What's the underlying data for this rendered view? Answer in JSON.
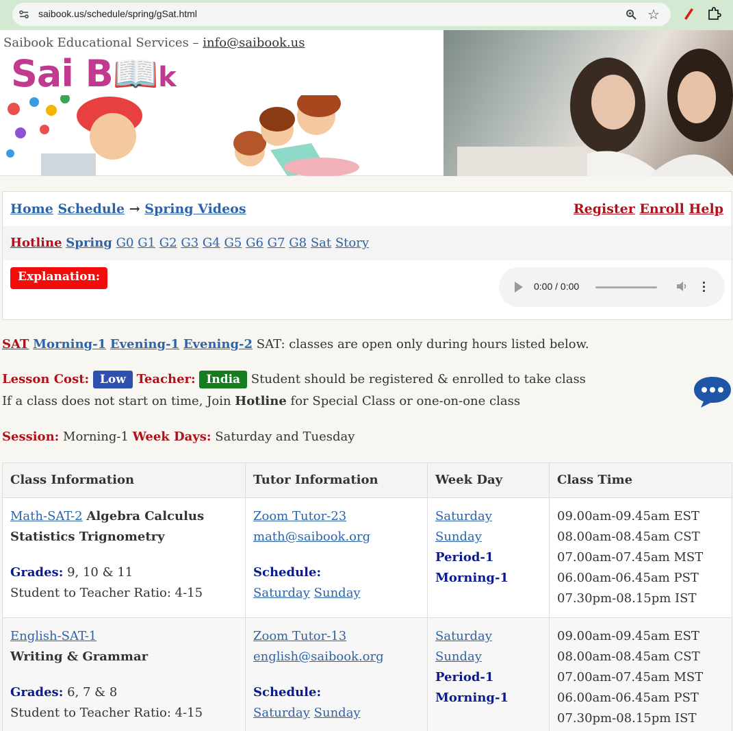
{
  "browser": {
    "url": "saibook.us/schedule/spring/gSat.html"
  },
  "header": {
    "org": "Saibook Educational Services – ",
    "email": "info@saibook.us",
    "logo_sai": "Sai B",
    "logo_k": "k"
  },
  "nav": {
    "home": "Home",
    "schedule": "Schedule",
    "arrow": "→",
    "spring_videos": "Spring Videos",
    "register": "Register",
    "enroll": "Enroll",
    "help": "Help",
    "hotline": "Hotline",
    "spring": "Spring",
    "grades": [
      "G0",
      "G1",
      "G2",
      "G3",
      "G4",
      "G5",
      "G6",
      "G7",
      "G8",
      "Sat",
      "Story"
    ],
    "explanation": "Explanation:",
    "audio_time": "0:00 / 0:00"
  },
  "sessions": {
    "sat": "SAT",
    "links": [
      "Morning-1",
      "Evening-1",
      "Evening-2"
    ],
    "note": "SAT: classes are open only during hours listed below."
  },
  "cost": {
    "label": "Lesson Cost:",
    "value": "Low",
    "teacher_label": "Teacher:",
    "teacher_value": "India",
    "note": "Student should be registered & enrolled to take class"
  },
  "late": {
    "pre": "If a class does not start on time, Join ",
    "hotline": "Hotline",
    "post": " for Special Class or one-on-one class"
  },
  "session": {
    "label": "Session:",
    "value": "Morning-1",
    "days_label": "Week Days:",
    "days_value": "Saturday and Tuesday"
  },
  "table": {
    "headers": [
      "Class Information",
      "Tutor Information",
      "Week Day",
      "Class Time"
    ],
    "rows": [
      {
        "class_link": "Math-SAT-2",
        "subject_a": "Algebra Calculus",
        "subject_b": "Statistics Trignometry",
        "grades_label": "Grades:",
        "grades": "9, 10 & 11",
        "ratio": "Student to Teacher Ratio: 4-15",
        "tutor": "Zoom Tutor-23",
        "email": "math@saibook.org",
        "schedule_label": "Schedule:",
        "sched1": "Saturday",
        "sched2": "Sunday",
        "day1": "Saturday",
        "day2": "Sunday",
        "period": "Period-1",
        "session": "Morning-1",
        "times": [
          "09.00am-09.45am EST",
          "08.00am-08.45am CST",
          "07.00am-07.45am MST",
          "06.00am-06.45am PST",
          "07.30pm-08.15pm IST"
        ]
      },
      {
        "class_link": "English-SAT-1",
        "subject_a": "",
        "subject_b": "Writing & Grammar",
        "grades_label": "Grades:",
        "grades": "6, 7 & 8",
        "ratio": "Student to Teacher Ratio: 4-15",
        "tutor": "Zoom Tutor-13",
        "email": "english@saibook.org",
        "schedule_label": "Schedule:",
        "sched1": "Saturday",
        "sched2": "Sunday",
        "day1": "Saturday",
        "day2": "Sunday",
        "period": "Period-1",
        "session": "Morning-1",
        "times": [
          "09.00am-09.45am EST",
          "08.00am-08.45am CST",
          "07.00am-07.45am MST",
          "06.00am-06.45am PST",
          "07.30pm-08.15pm IST"
        ]
      }
    ]
  },
  "colors": {
    "accent_red": "#b0101a",
    "link_blue": "#2d63a8",
    "navy": "#0b1b8a"
  }
}
